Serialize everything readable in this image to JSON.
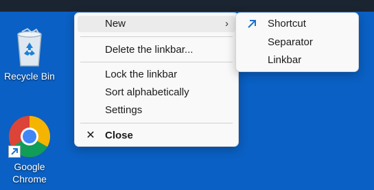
{
  "desktop": {
    "icons": [
      {
        "label": "Recycle Bin",
        "icon": "recycle-bin-icon"
      },
      {
        "label": "Google Chrome",
        "icon": "chrome-icon"
      }
    ]
  },
  "context_menu": {
    "items": [
      {
        "label": "New",
        "trailing_icon": "chevron-right-icon",
        "trailing_glyph": "›"
      },
      {
        "label": "Delete the linkbar..."
      },
      {
        "label": "Lock the linkbar"
      },
      {
        "label": "Sort alphabetically"
      },
      {
        "label": "Settings"
      },
      {
        "label": "Close",
        "leading_icon": "close-icon",
        "leading_glyph": "✕"
      }
    ]
  },
  "submenu": {
    "items": [
      {
        "label": "Shortcut",
        "leading_icon": "shortcut-arrow-icon"
      },
      {
        "label": "Separator"
      },
      {
        "label": "Linkbar"
      }
    ]
  },
  "colors": {
    "desktop_background": "#0a60c4",
    "taskbar": "#1b2431",
    "menu_background": "#f9f9f9",
    "shortcut_arrow": "#1a73c8"
  }
}
